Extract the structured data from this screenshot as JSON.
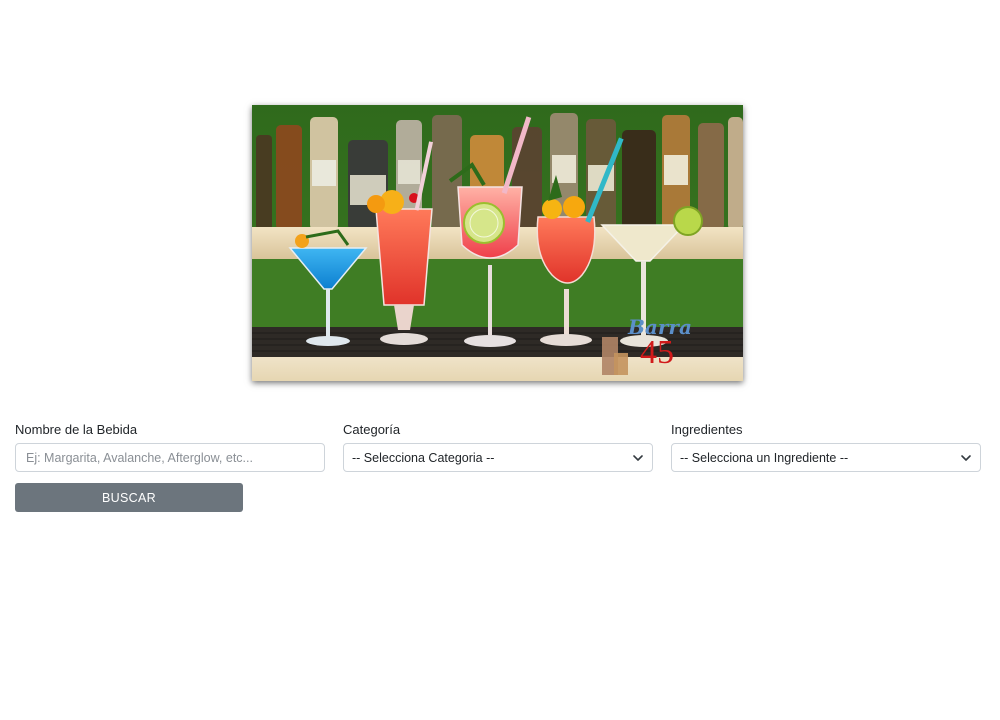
{
  "hero": {
    "image_alt": "cocktails-on-bar-counter",
    "logo_script": "Barra",
    "logo_number": "45"
  },
  "form": {
    "name_label": "Nombre de la Bebida",
    "name_placeholder": "Ej: Margarita, Avalanche, Afterglow, etc...",
    "category_label": "Categoría",
    "category_selected": "-- Selecciona Categoria --",
    "ingredient_label": "Ingredientes",
    "ingredient_selected": "-- Selecciona un Ingrediente --",
    "search_button": "BUSCAR"
  },
  "colors": {
    "button_bg": "#6c757d",
    "input_border": "#ced4da",
    "logo_red": "#d11a1a",
    "logo_blue": "#5b8fc9"
  }
}
